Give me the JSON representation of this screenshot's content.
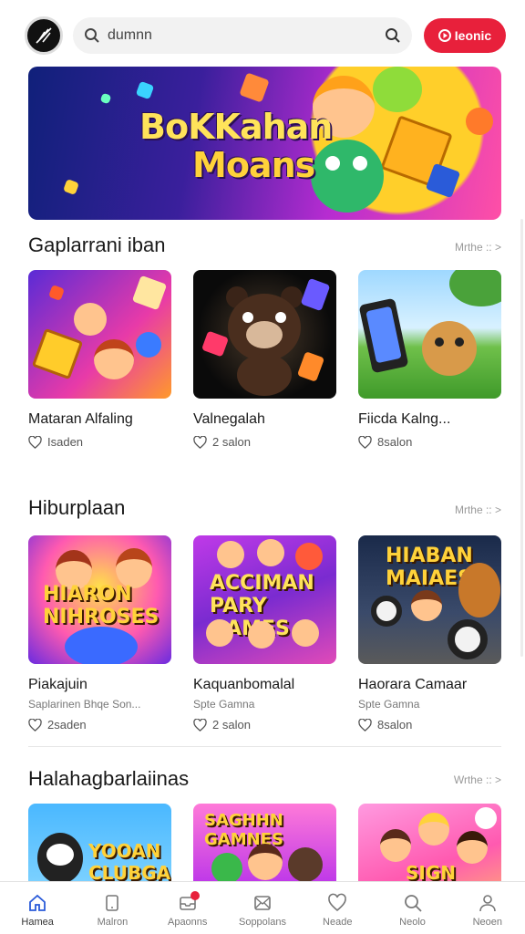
{
  "search": {
    "placeholder": "dumnn"
  },
  "header": {
    "cta_label": "Ieonic"
  },
  "hero": {
    "line1": "BoKKahan",
    "line2": "Moans"
  },
  "sections": [
    {
      "title": "Gaplarrani iban",
      "more": "Mrthe :: >",
      "cards": [
        {
          "name": "Mataran Alfaling",
          "sub": "",
          "likes": "Isaden"
        },
        {
          "name": "Valnegalah",
          "sub": "",
          "likes": "2 salon"
        },
        {
          "name": "Fiicda Kalng...",
          "sub": "",
          "likes": "8salon"
        }
      ]
    },
    {
      "title": "Hiburplaan",
      "more": "Mrthe :: >",
      "cards": [
        {
          "name": "Piakajuin",
          "sub": "Saplarinen Bhqe Son...",
          "likes": "2saden",
          "art": "HIARON NIHROSES"
        },
        {
          "name": "Kaquanbomalal",
          "sub": "Spte Gamna",
          "likes": "2 salon",
          "art": "ACCIMAN PARY GAMES"
        },
        {
          "name": "Haorara Camaar",
          "sub": "Spte Gamna",
          "likes": "8salon",
          "art": "HIABAN MAIAES"
        }
      ]
    },
    {
      "title": "Halahagbarlaiinas",
      "more": "Wrthe :: >",
      "cards": [
        {
          "art": "YOOAN CLUBGAMES"
        },
        {
          "art": "SAGHHN GAMNES"
        },
        {
          "art": "SIGN"
        }
      ]
    }
  ],
  "nav": [
    {
      "label": "Hamea",
      "icon": "home-icon"
    },
    {
      "label": "Malron",
      "icon": "tablet-icon"
    },
    {
      "label": "Apaonns",
      "icon": "inbox-icon"
    },
    {
      "label": "Soppolans",
      "icon": "envelope-icon"
    },
    {
      "label": "Neade",
      "icon": "heart-icon"
    },
    {
      "label": "Neolo",
      "icon": "search-icon"
    },
    {
      "label": "Neoen",
      "icon": "person-icon"
    }
  ],
  "colors": {
    "accent": "#e8203b"
  }
}
